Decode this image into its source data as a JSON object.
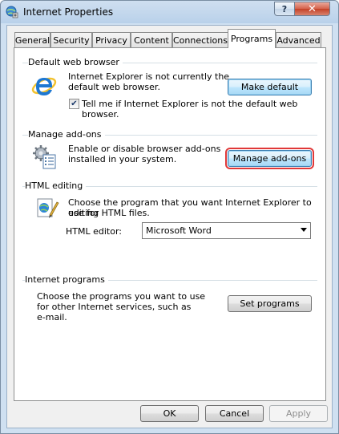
{
  "window": {
    "title": "Internet Properties",
    "help_label": "?",
    "close_label": "✕"
  },
  "tabs": [
    {
      "label": "General",
      "active": false
    },
    {
      "label": "Security",
      "active": false
    },
    {
      "label": "Privacy",
      "active": false
    },
    {
      "label": "Content",
      "active": false
    },
    {
      "label": "Connections",
      "active": false
    },
    {
      "label": "Programs",
      "active": true
    },
    {
      "label": "Advanced",
      "active": false
    }
  ],
  "default_browser": {
    "heading": "Default web browser",
    "status_line1": "Internet Explorer is not currently the",
    "status_line2": "default web browser.",
    "make_default_label": "Make default",
    "checkbox_label": "Tell me if Internet Explorer is not the default web browser.",
    "checkbox_checked": true
  },
  "addons": {
    "heading": "Manage add-ons",
    "desc_line1": "Enable or disable browser add-ons",
    "desc_line2": "installed in your system.",
    "button_label": "Manage add-ons"
  },
  "html_editing": {
    "heading": "HTML editing",
    "desc_line1": "Choose the program that you want Internet Explorer to use for",
    "desc_line2": "editing HTML files.",
    "editor_label": "HTML editor:",
    "editor_value": "Microsoft Word"
  },
  "internet_programs": {
    "heading": "Internet programs",
    "desc_line1": "Choose the programs you want to use",
    "desc_line2": "for other Internet services, such as",
    "desc_line3": "e-mail.",
    "button_label": "Set programs"
  },
  "footer": {
    "ok_label": "OK",
    "cancel_label": "Cancel",
    "apply_label": "Apply"
  },
  "colors": {
    "highlight_border": "#e03838",
    "ie_blue": "#1e78d2"
  }
}
